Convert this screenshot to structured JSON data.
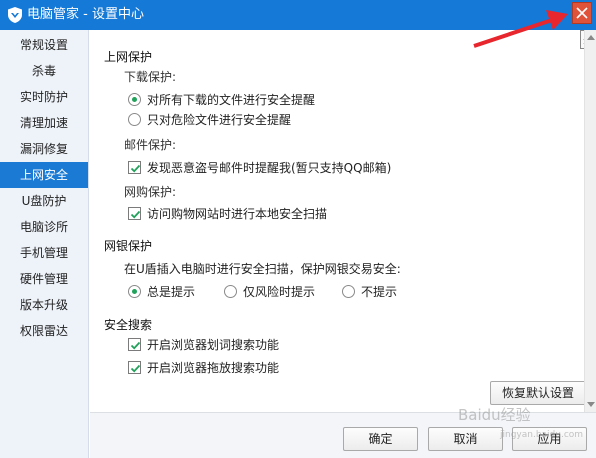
{
  "window": {
    "title": "电脑管家 - 设置中心",
    "close_tooltip": "关",
    "accent_color": "#1479d7",
    "close_color": "#e0533b"
  },
  "sidebar": {
    "items": [
      {
        "label": "常规设置",
        "active": false
      },
      {
        "label": "杀毒",
        "active": false
      },
      {
        "label": "实时防护",
        "active": false
      },
      {
        "label": "清理加速",
        "active": false
      },
      {
        "label": "漏洞修复",
        "active": false
      },
      {
        "label": "上网安全",
        "active": true
      },
      {
        "label": "U盘防护",
        "active": false
      },
      {
        "label": "电脑诊所",
        "active": false
      },
      {
        "label": "手机管理",
        "active": false
      },
      {
        "label": "硬件管理",
        "active": false
      },
      {
        "label": "版本升级",
        "active": false
      },
      {
        "label": "权限雷达",
        "active": false
      }
    ]
  },
  "net_protection": {
    "title": "上网保护",
    "download": {
      "label": "下载保护:",
      "options": [
        {
          "label": "对所有下载的文件进行安全提醒",
          "selected": true
        },
        {
          "label": "只对危险文件进行安全提醒",
          "selected": false
        }
      ]
    },
    "mail": {
      "label": "邮件保护:",
      "option": {
        "label": "发现恶意盗号邮件时提醒我(暂只支持QQ邮箱)",
        "checked": true
      }
    },
    "shopping": {
      "label": "网购保护:",
      "option": {
        "label": "访问购物网站时进行本地安全扫描",
        "checked": true
      }
    }
  },
  "bank_protection": {
    "title": "网银保护",
    "description": "在U盾插入电脑时进行安全扫描，保护网银交易安全:",
    "options": [
      {
        "label": "总是提示",
        "selected": true
      },
      {
        "label": "仅风险时提示",
        "selected": false
      },
      {
        "label": "不提示",
        "selected": false
      }
    ]
  },
  "safe_search": {
    "title": "安全搜索",
    "options": [
      {
        "label": "开启浏览器划词搜索功能",
        "checked": true
      },
      {
        "label": "开启浏览器拖放搜索功能",
        "checked": true
      }
    ]
  },
  "buttons": {
    "restore_default": "恢复默认设置",
    "ok": "确定",
    "cancel": "取消",
    "apply": "应用"
  },
  "watermark": {
    "text": "Baidu经验",
    "url": "jingyan.baidu.com"
  }
}
